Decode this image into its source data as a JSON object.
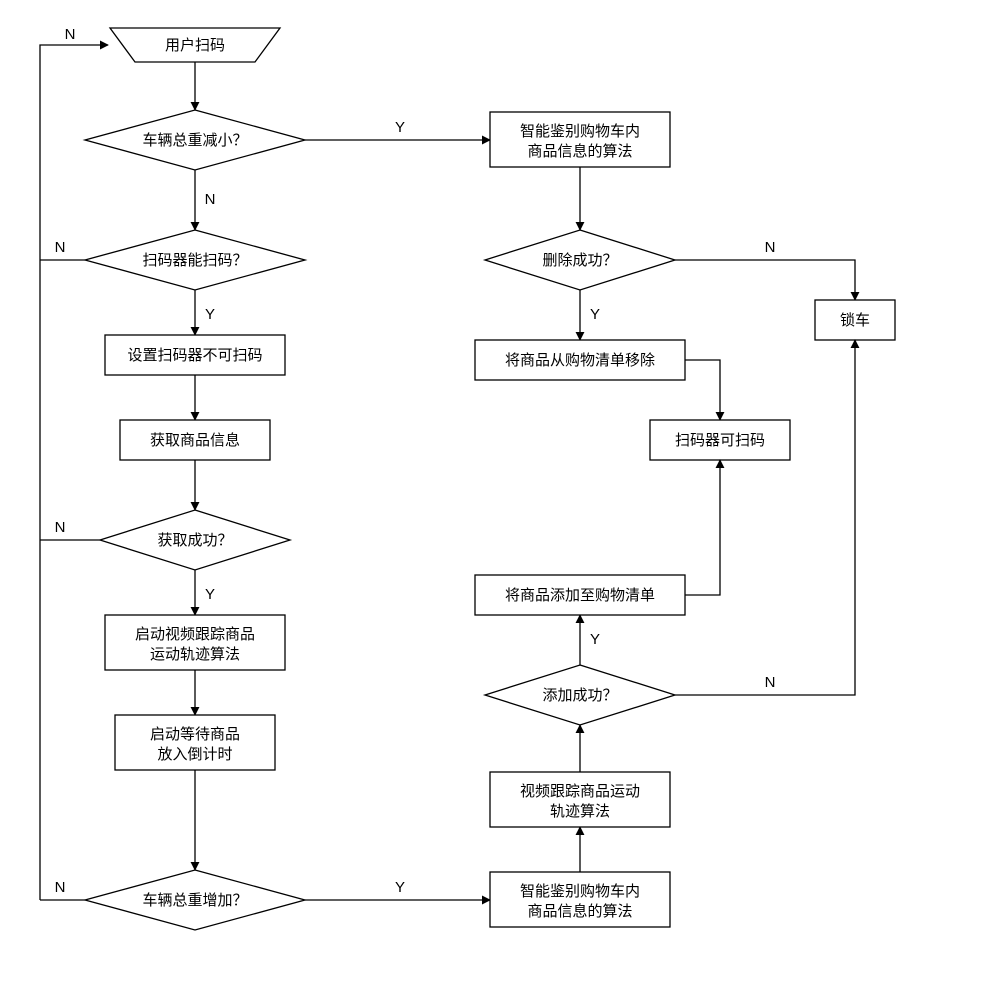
{
  "nodes": {
    "start": "用户扫码",
    "d_weight_dec": "车辆总重减小？",
    "algo_identify_top": [
      "智能鉴别购物车内",
      "商品信息的算法"
    ],
    "d_delete_ok": "删除成功？",
    "remove_item": "将商品从购物清单移除",
    "lock": "锁车",
    "scanner_ok": "扫码器可扫码",
    "d_can_scan": "扫码器能扫码？",
    "set_no_scan": "设置扫码器不可扫码",
    "get_info": "获取商品信息",
    "d_get_ok": "获取成功？",
    "start_track": [
      "启动视频跟踪商品",
      "运动轨迹算法"
    ],
    "start_countdown": [
      "启动等待商品",
      "放入倒计时"
    ],
    "d_weight_inc": "车辆总重增加？",
    "algo_identify_bot": [
      "智能鉴别购物车内",
      "商品信息的算法"
    ],
    "track_algo": [
      "视频跟踪商品运动",
      "轨迹算法"
    ],
    "d_add_ok": "添加成功？",
    "add_item": "将商品添加至购物清单"
  },
  "labels": {
    "Y": "Y",
    "N": "N"
  }
}
